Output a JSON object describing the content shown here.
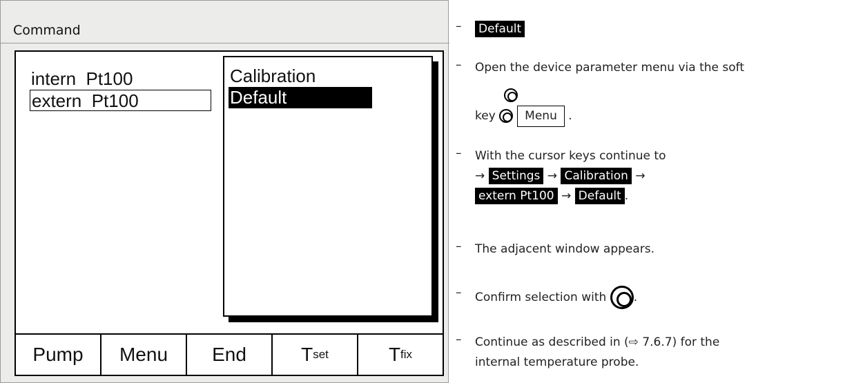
{
  "command": {
    "title": "Command"
  },
  "display": {
    "list": [
      "intern  Pt100",
      "extern  Pt100"
    ],
    "popup": [
      "Calibration",
      "Default"
    ]
  },
  "softkeys": {
    "pump": "Pump",
    "menu": "Menu",
    "end": "End",
    "tset_main": "T",
    "tset_sub": "set",
    "tfix_main": "T",
    "tfix_sub": "fix"
  },
  "instructions": {
    "step1_label": "Default",
    "step2_text": "Open the device parameter menu via the soft",
    "step2_key": "key",
    "step2_menu": "Menu",
    "step3_text": "With the cursor keys continue to",
    "nav_arrow": "→",
    "nav_settings": "Settings",
    "nav_calibration": "Calibration",
    "nav_extern": "extern Pt100",
    "nav_default": "Default",
    "step4_text": "The adjacent window appears.",
    "step5_text": "Confirm selection with",
    "step6_line1": "Continue as described in (⇨ 7.6.7) for the",
    "step6_line2": "internal temperature probe."
  },
  "icons": {
    "knob": "rotary-knob-icon"
  }
}
